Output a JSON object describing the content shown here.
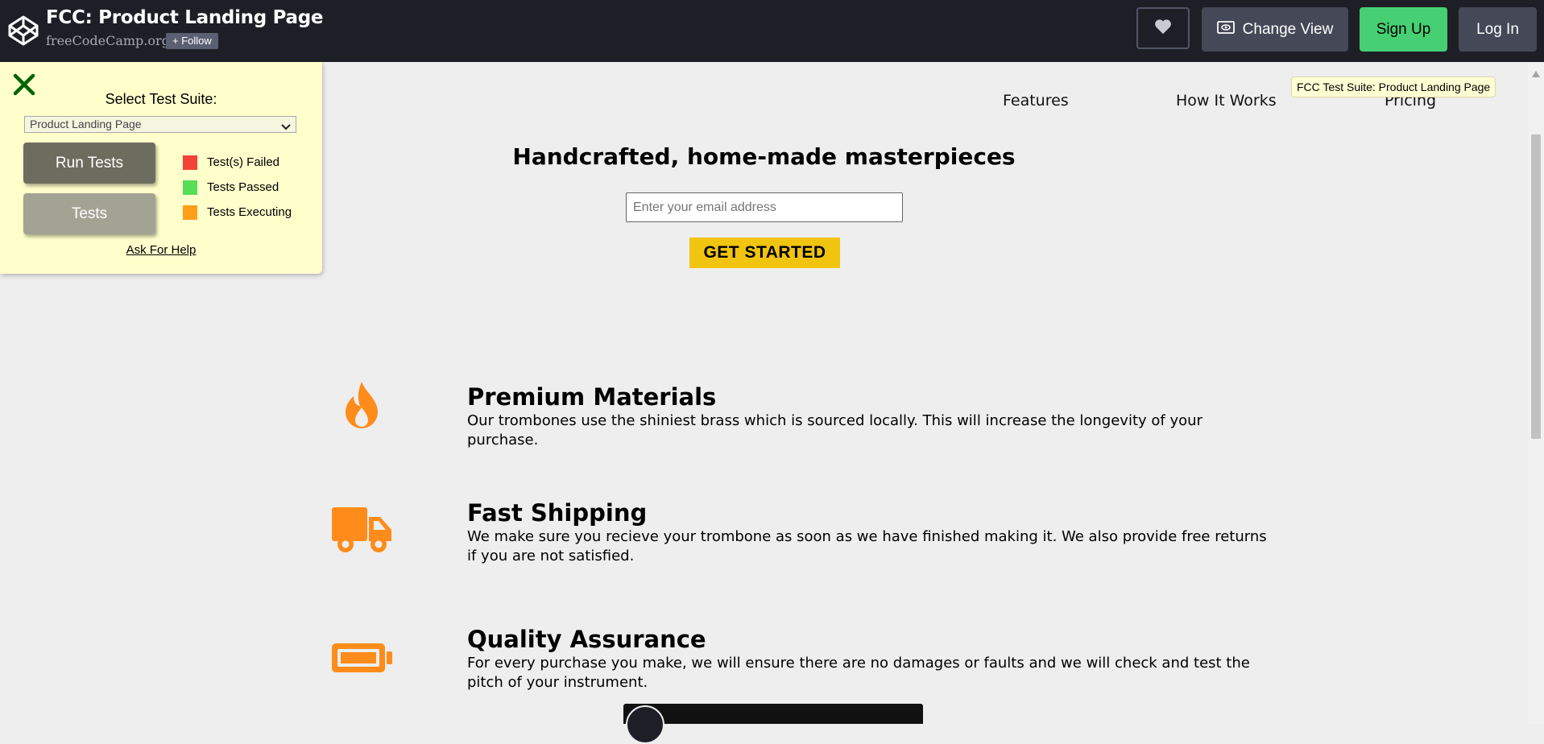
{
  "codepen": {
    "title": "FCC: Product Landing Page",
    "owner": "freeCodeCamp.org",
    "follow_label": "+ Follow",
    "change_view_label": "Change View",
    "signup_label": "Sign Up",
    "login_label": "Log In"
  },
  "page": {
    "nav": [
      "Features",
      "How It Works",
      "Pricing"
    ],
    "hero_title": "Handcrafted, home-made masterpieces",
    "email_placeholder": "Enter your email address",
    "cta_label": "GET STARTED",
    "features": [
      {
        "icon": "fire-icon",
        "title": "Premium Materials",
        "description": "Our trombones use the shiniest brass which is sourced locally. This will increase the longevity of your purchase."
      },
      {
        "icon": "truck-icon",
        "title": "Fast Shipping",
        "description": "We make sure you recieve your trombone as soon as we have finished making it. We also provide free returns if you are not satisfied."
      },
      {
        "icon": "battery-icon",
        "title": "Quality Assurance",
        "description": "For every purchase you make, we will ensure there are no damages or faults and we will check and test the pitch of your instrument."
      }
    ],
    "accent_color": "#ff8c1a"
  },
  "tooltip": "FCC Test Suite: Product Landing Page",
  "fcc_panel": {
    "select_label": "Select Test Suite:",
    "selected_suite": "Product Landing Page",
    "run_tests_label": "Run Tests",
    "tests_label": "Tests",
    "legend": [
      {
        "label": "Test(s) Failed",
        "color": "#f44336"
      },
      {
        "label": "Tests Passed",
        "color": "#55dd55"
      },
      {
        "label": "Tests Executing",
        "color": "#ff9f1a"
      }
    ],
    "help_label": "Ask For Help"
  }
}
